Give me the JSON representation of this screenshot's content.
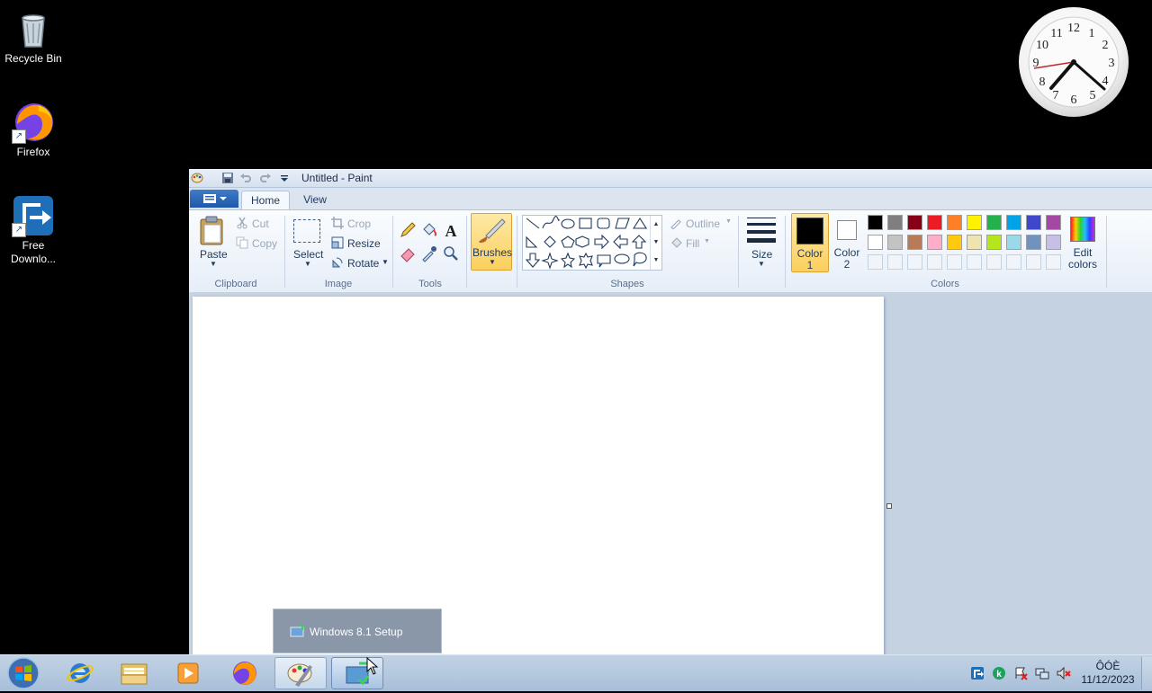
{
  "desktop": {
    "icons": [
      {
        "label": "Recycle Bin",
        "icon": "recycle-bin-icon"
      },
      {
        "label": "Firefox",
        "icon": "firefox-icon"
      },
      {
        "label": "Free Downlo...",
        "icon": "free-download-manager-icon"
      }
    ]
  },
  "clock_gadget": {
    "numbers": [
      "12",
      "1",
      "2",
      "3",
      "4",
      "5",
      "6",
      "7",
      "8",
      "9",
      "10",
      "11"
    ]
  },
  "paint": {
    "title": "Untitled - Paint",
    "tabs": [
      "Home",
      "View"
    ],
    "clipboard": {
      "paste": "Paste",
      "cut": "Cut",
      "copy": "Copy",
      "group": "Clipboard"
    },
    "image": {
      "select": "Select",
      "crop": "Crop",
      "resize": "Resize",
      "rotate": "Rotate",
      "group": "Image"
    },
    "tools": {
      "group": "Tools"
    },
    "brushes": {
      "label": "Brushes"
    },
    "shapes": {
      "outline": "Outline",
      "fill": "Fill",
      "group": "Shapes"
    },
    "size": {
      "label": "Size"
    },
    "color1": {
      "label": "Color",
      "num": "1",
      "value": "#000000"
    },
    "color2": {
      "label": "Color",
      "num": "2",
      "value": "#ffffff"
    },
    "colors": {
      "group": "Colors",
      "edit_line1": "Edit",
      "edit_line2": "colors",
      "palette_row1": [
        "#000000",
        "#7f7f7f",
        "#880015",
        "#ed1c24",
        "#ff7f27",
        "#fff200",
        "#22b14c",
        "#00a2e8",
        "#3f48cc",
        "#a349a4"
      ],
      "palette_row2": [
        "#ffffff",
        "#c3c3c3",
        "#b97a57",
        "#ffaec9",
        "#ffc90e",
        "#efe4b0",
        "#b5e61d",
        "#99d9ea",
        "#7092be",
        "#c8bfe7"
      ]
    }
  },
  "taskbar": {
    "popup_label": "Windows 8.1 Setup",
    "clock_line1": "ÔÓÈ",
    "clock_line2": "11/12/2023"
  }
}
